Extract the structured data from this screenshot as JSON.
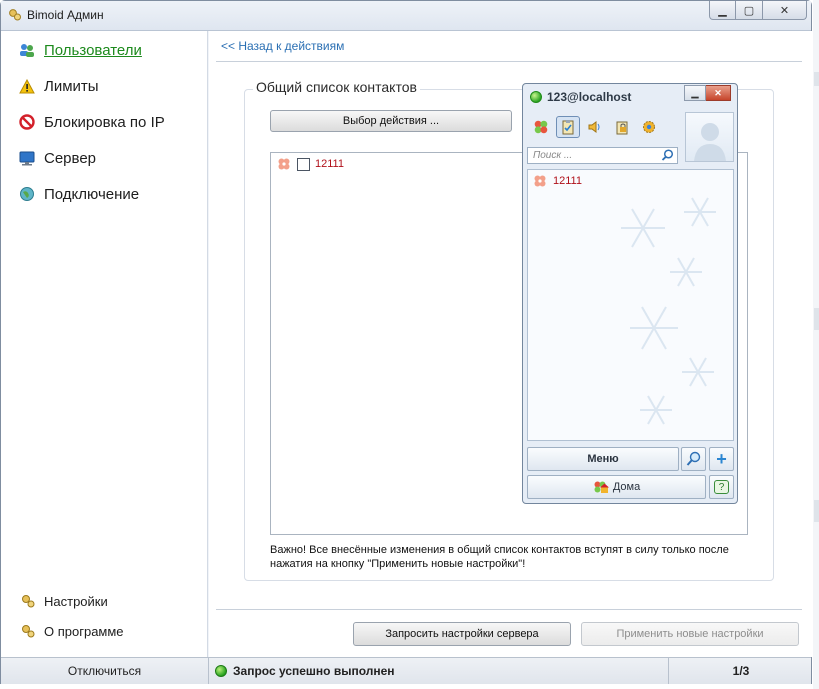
{
  "window": {
    "title": "Bimoid Админ",
    "caption": {
      "minimize": "▭",
      "maximize": "▢",
      "close": "✕"
    }
  },
  "sidebar": {
    "items": [
      {
        "label": "Пользователи",
        "icon": "users-icon",
        "active": true
      },
      {
        "label": "Лимиты",
        "icon": "warning-icon",
        "active": false
      },
      {
        "label": "Блокировка по IP",
        "icon": "block-icon",
        "active": false
      },
      {
        "label": "Сервер",
        "icon": "monitor-icon",
        "active": false
      },
      {
        "label": "Подключение",
        "icon": "globe-icon",
        "active": false
      }
    ],
    "bottom": [
      {
        "label": "Настройки",
        "icon": "settings-icon"
      },
      {
        "label": "О программе",
        "icon": "about-icon"
      }
    ]
  },
  "main": {
    "back_link": "<< Назад к действиям",
    "group_title": "Общий список контактов",
    "action_button": "Выбор действия ...",
    "contacts": [
      {
        "name": "12111",
        "checked": false
      }
    ],
    "note": "Важно! Все внесённые изменения в общий список контактов вступят в силу только после нажатия на кнопку \"Применить новые настройки\"!",
    "request_button": "Запросить настройки сервера",
    "apply_button": "Применить новые настройки"
  },
  "statusbar": {
    "disconnect": "Отключиться",
    "status": "Запрос успешно выполнен",
    "page": "1/3"
  },
  "client": {
    "title": "123@localhost",
    "search_placeholder": "Поиск ...",
    "contacts": [
      {
        "name": "12111"
      }
    ],
    "menu_button": "Меню",
    "status_button": "Дома",
    "help_button": "?",
    "add_button": "+"
  },
  "colors": {
    "accent_link": "#2a6fb3",
    "active_nav": "#1d8a1d",
    "contact_name": "#b0101a",
    "status_ok": "#27a21f"
  }
}
